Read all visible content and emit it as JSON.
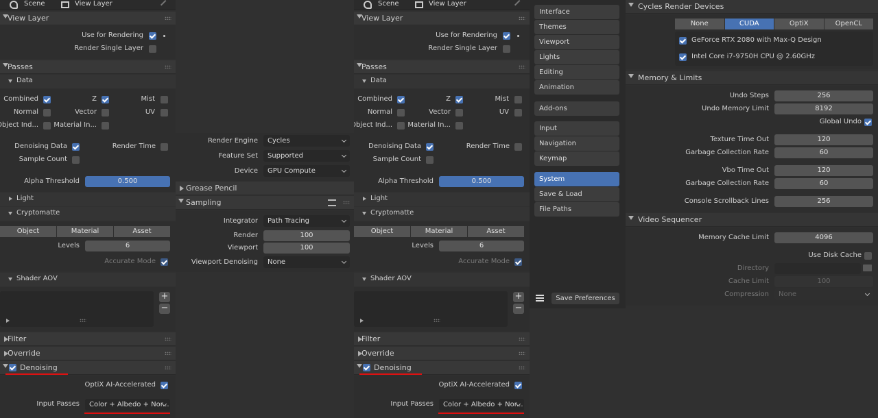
{
  "left_panel": {
    "header": {
      "scene": "Scene",
      "view_layer": "View Layer"
    },
    "view_layer": {
      "title": "View Layer",
      "use_for_rendering": "Use for Rendering",
      "render_single_layer": "Render Single Layer"
    },
    "passes": {
      "title": "Passes",
      "data": {
        "title": "Data",
        "combined": "Combined",
        "z": "Z",
        "mist": "Mist",
        "normal": "Normal",
        "vector": "Vector",
        "uv": "UV",
        "object_index": "Object Ind...",
        "material_index": "Material In...",
        "denoising_data": "Denoising Data",
        "render_time": "Render Time",
        "sample_count": "Sample Count",
        "alpha_threshold_label": "Alpha Threshold",
        "alpha_threshold_value": "0.500"
      },
      "light": "Light",
      "cryptomatte": {
        "title": "Cryptomatte",
        "object": "Object",
        "material": "Material",
        "asset": "Asset",
        "levels_label": "Levels",
        "levels_value": "6",
        "accurate_mode": "Accurate Mode"
      },
      "shader_aov": "Shader AOV"
    },
    "filter": "Filter",
    "override": "Override",
    "denoising": {
      "title": "Denoising",
      "optix": "OptiX AI-Accelerated",
      "input_passes_label": "Input Passes",
      "input_passes_value": "Color + Albedo + Nor..."
    }
  },
  "render_panel": {
    "render_engine_label": "Render Engine",
    "render_engine_value": "Cycles",
    "feature_set_label": "Feature Set",
    "feature_set_value": "Supported",
    "device_label": "Device",
    "device_value": "GPU Compute",
    "grease_pencil": "Grease Pencil",
    "sampling": "Sampling",
    "integrator_label": "Integrator",
    "integrator_value": "Path Tracing",
    "render_label": "Render",
    "render_value": "100",
    "viewport_label": "Viewport",
    "viewport_value": "100",
    "viewport_denoising_label": "Viewport Denoising",
    "viewport_denoising_value": "None"
  },
  "prefs_nav": {
    "group1": [
      "Interface",
      "Themes",
      "Viewport",
      "Lights",
      "Editing",
      "Animation"
    ],
    "group2": [
      "Add-ons"
    ],
    "group3": [
      "Input",
      "Navigation",
      "Keymap"
    ],
    "group4": [
      "System",
      "Save & Load",
      "File Paths"
    ],
    "save_preferences": "Save Preferences"
  },
  "prefs_main": {
    "cycles": {
      "title": "Cycles Render Devices",
      "tabs": [
        "None",
        "CUDA",
        "OptiX",
        "OpenCL"
      ],
      "selected_tab": "CUDA",
      "device1": "GeForce RTX 2080 with Max-Q Design",
      "device2": "Intel Core i7-9750H CPU @ 2.60GHz"
    },
    "memory": {
      "title": "Memory & Limits",
      "undo_steps_label": "Undo Steps",
      "undo_steps": "256",
      "undo_memory_label": "Undo Memory Limit",
      "undo_memory": "8192",
      "global_undo": "Global Undo",
      "texture_timeout_label": "Texture Time Out",
      "texture_timeout": "120",
      "gc_rate_label": "Garbage Collection Rate",
      "gc_rate": "60",
      "vbo_timeout_label": "Vbo Time Out",
      "vbo_timeout": "120",
      "gc_rate2_label": "Garbage Collection Rate",
      "gc_rate2": "60",
      "console_label": "Console Scrollback Lines",
      "console": "256"
    },
    "vse": {
      "title": "Video Sequencer",
      "mem_cache_label": "Memory Cache Limit",
      "mem_cache": "4096",
      "use_disk_cache": "Use Disk Cache",
      "directory_label": "Directory",
      "cache_limit_label": "Cache Limit",
      "cache_limit": "100",
      "compression_label": "Compression",
      "compression": "None"
    }
  },
  "colors": {
    "accent": "#4772b3",
    "annotation": "#e01010",
    "bg": "#303030"
  }
}
